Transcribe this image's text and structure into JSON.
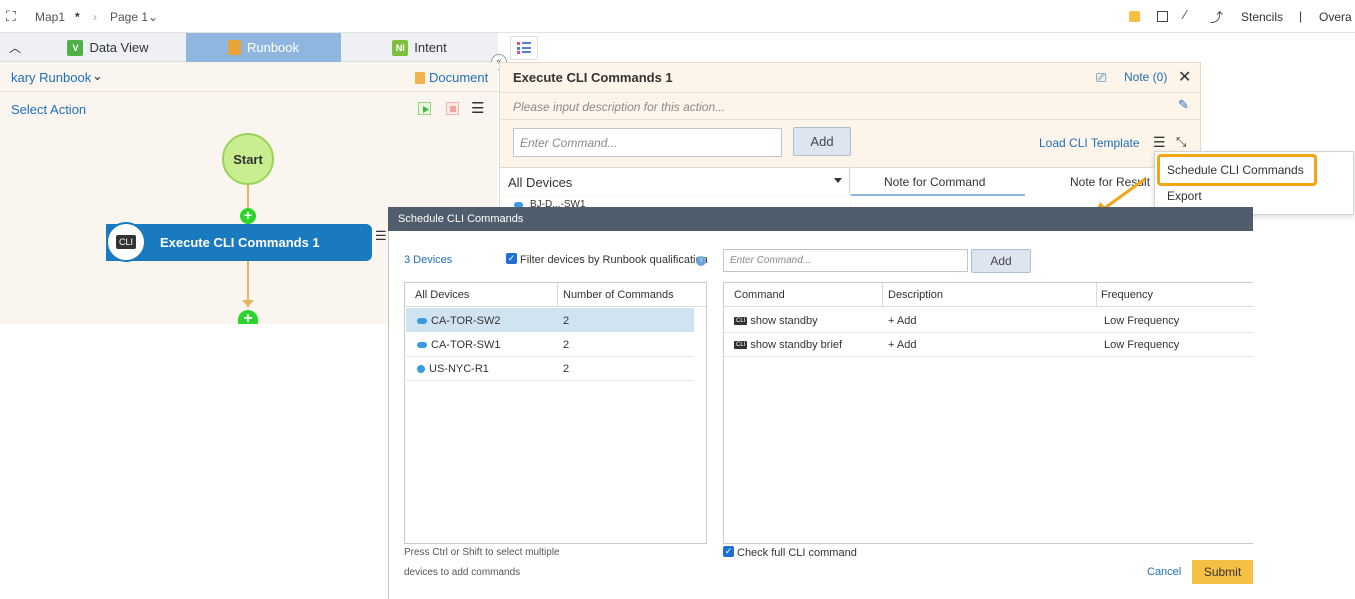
{
  "topbar": {
    "map_name": "Map1",
    "modified_marker": "*",
    "page_name": "Page 1",
    "stencils_label": "Stencils",
    "separator": "|",
    "overview_label": "Overa"
  },
  "tabs": [
    {
      "label": "Data View",
      "badge": "V",
      "badge_color": "#4fb04a"
    },
    {
      "label": "Runbook",
      "badge": "",
      "badge_color": "#e8a43a"
    },
    {
      "label": "Intent",
      "badge": "NI",
      "badge_color": "#7fbf3f"
    }
  ],
  "left": {
    "runbook_title": "kary Runbook",
    "document_label": "Document",
    "select_action_label": "Select Action",
    "start_label": "Start",
    "exec_node_label": "Execute CLI Commands 1",
    "cli_badge": "CLI"
  },
  "action_panel": {
    "title": "Execute CLI Commands 1",
    "note_label": "Note (0)",
    "description_placeholder": "Please input description for this action...",
    "command_placeholder": "Enter Command...",
    "add_label": "Add",
    "load_template_label": "Load CLI Template",
    "devices_dropdown": "All Devices",
    "tab_note_command": "Note for Command",
    "tab_note_result": "Note for Result",
    "clipped_device": "BJ-D...-SW1"
  },
  "context_menu": {
    "items": [
      "Schedule CLI Commands",
      "Export"
    ]
  },
  "dialog": {
    "title": "Schedule CLI Commands",
    "device_count": "3 Devices",
    "filter_label": "Filter devices by Runbook qualification",
    "command_placeholder": "Enter Command...",
    "add_label": "Add",
    "devices_columns": [
      "All Devices",
      "Number of Commands"
    ],
    "devices": [
      {
        "name": "CA-TOR-SW2",
        "count": "2"
      },
      {
        "name": "CA-TOR-SW1",
        "count": "2"
      },
      {
        "name": "US-NYC-R1",
        "count": "2"
      }
    ],
    "commands_columns": [
      "Command",
      "Description",
      "Frequency"
    ],
    "commands": [
      {
        "command": "show standby",
        "description": "+ Add",
        "frequency": "Low Frequency"
      },
      {
        "command": "show standby brief",
        "description": "+ Add",
        "frequency": "Low Frequency"
      }
    ],
    "hint_line1": "Press Ctrl or Shift to select multiple",
    "hint_line2": "devices to add commands",
    "check_full_label": "Check full CLI command",
    "cancel_label": "Cancel",
    "submit_label": "Submit"
  },
  "colors": {
    "accent_blue": "#1a7abf",
    "highlight_orange": "#f2a616",
    "submit_yellow": "#f5c043",
    "dialog_header": "#4f5d6c"
  }
}
